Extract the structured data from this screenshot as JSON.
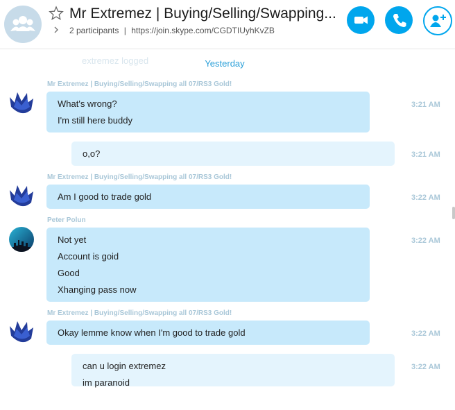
{
  "header": {
    "title": "Mr Extremez | Buying/Selling/Swapping...",
    "participants": "2 participants",
    "separator": "|",
    "join_link": "https://join.skype.com/CGDTIUyhKvZB",
    "icons": [
      "group-avatar-icon",
      "favorite-star-icon",
      "chevron-right-icon",
      "video-call-icon",
      "audio-call-icon",
      "add-people-icon"
    ],
    "accent_color": "#00a6ed"
  },
  "chat": {
    "ghost_text": "extremez logged",
    "day_divider": "Yesterday",
    "messages": [
      {
        "sender": "Mr Extremez | Buying/Selling/Swapping all 07/RS3 Gold!",
        "lines": [
          "What's wrong?",
          "I'm still here buddy"
        ],
        "time": "3:21 AM"
      },
      {
        "sender": "",
        "lines": [
          "o,o?"
        ],
        "time": "3:21 AM"
      },
      {
        "sender": "Mr Extremez | Buying/Selling/Swapping all 07/RS3 Gold!",
        "lines": [
          "Am I good to trade gold"
        ],
        "time": "3:22 AM"
      },
      {
        "sender": "Peter Polun",
        "lines": [
          "Not yet",
          "Account is goid",
          "Good",
          "Xhanging pass now"
        ],
        "time": "3:22 AM"
      },
      {
        "sender": "Mr Extremez | Buying/Selling/Swapping all 07/RS3 Gold!",
        "lines": [
          "Okay lemme know when I'm good to trade gold"
        ],
        "time": "3:22 AM"
      },
      {
        "sender": "",
        "lines": [
          "can u login extremez",
          "im paranoid"
        ],
        "time": "3:22 AM"
      }
    ]
  }
}
